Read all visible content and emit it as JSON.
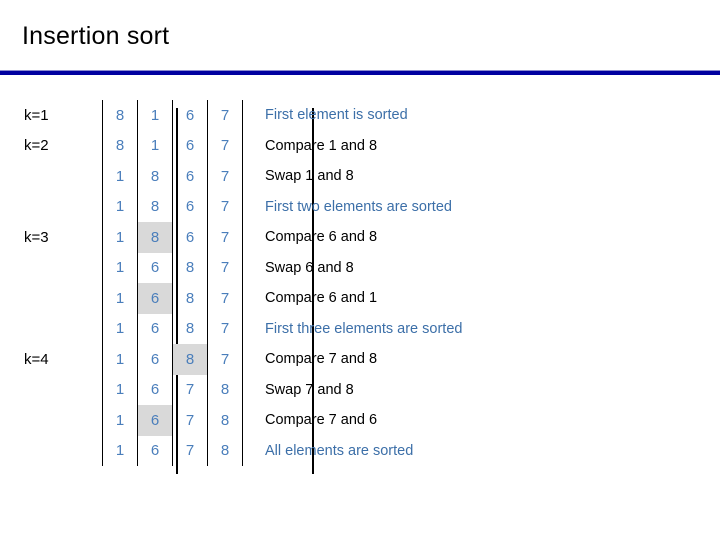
{
  "slide": {
    "title": "Insertion sort",
    "accent_color": "#0000a0",
    "number_color": "#4a7ebb",
    "highlight_color": "#d9d9d9"
  },
  "columns": [
    "c0",
    "c1",
    "c2",
    "c3"
  ],
  "rows": [
    {
      "k": "k=1",
      "values": [
        "8",
        "1",
        "6",
        "7"
      ],
      "highlight": [
        false,
        false,
        false,
        false
      ],
      "desc": "First element is sorted",
      "desc_dark": false
    },
    {
      "k": "k=2",
      "values": [
        "8",
        "1",
        "6",
        "7"
      ],
      "highlight": [
        false,
        false,
        false,
        false
      ],
      "desc": "Compare 1 and 8",
      "desc_dark": true
    },
    {
      "k": "",
      "values": [
        "1",
        "8",
        "6",
        "7"
      ],
      "highlight": [
        false,
        false,
        false,
        false
      ],
      "desc": "Swap 1 and 8",
      "desc_dark": true
    },
    {
      "k": "",
      "values": [
        "1",
        "8",
        "6",
        "7"
      ],
      "highlight": [
        false,
        false,
        false,
        false
      ],
      "desc": "First two elements are sorted",
      "desc_dark": false
    },
    {
      "k": "k=3",
      "values": [
        "1",
        "8",
        "6",
        "7"
      ],
      "highlight": [
        false,
        true,
        false,
        false
      ],
      "desc": "Compare 6 and 8",
      "desc_dark": true
    },
    {
      "k": "",
      "values": [
        "1",
        "6",
        "8",
        "7"
      ],
      "highlight": [
        false,
        false,
        false,
        false
      ],
      "desc": "Swap 6 and 8",
      "desc_dark": true
    },
    {
      "k": "",
      "values": [
        "1",
        "6",
        "8",
        "7"
      ],
      "highlight": [
        false,
        true,
        false,
        false
      ],
      "desc": "Compare 6 and 1",
      "desc_dark": true
    },
    {
      "k": "",
      "values": [
        "1",
        "6",
        "8",
        "7"
      ],
      "highlight": [
        false,
        false,
        false,
        false
      ],
      "desc": "First three elements are sorted",
      "desc_dark": false
    },
    {
      "k": "k=4",
      "values": [
        "1",
        "6",
        "8",
        "7"
      ],
      "highlight": [
        false,
        false,
        true,
        false
      ],
      "desc": "Compare 7 and 8",
      "desc_dark": true
    },
    {
      "k": "",
      "values": [
        "1",
        "6",
        "7",
        "8"
      ],
      "highlight": [
        false,
        false,
        false,
        false
      ],
      "desc": "Swap 7 and 8",
      "desc_dark": true
    },
    {
      "k": "",
      "values": [
        "1",
        "6",
        "7",
        "8"
      ],
      "highlight": [
        false,
        true,
        false,
        false
      ],
      "desc": "Compare 7 and 6",
      "desc_dark": true
    },
    {
      "k": "",
      "values": [
        "1",
        "6",
        "7",
        "8"
      ],
      "highlight": [
        false,
        false,
        false,
        false
      ],
      "desc": "All elements are sorted",
      "desc_dark": false
    }
  ]
}
